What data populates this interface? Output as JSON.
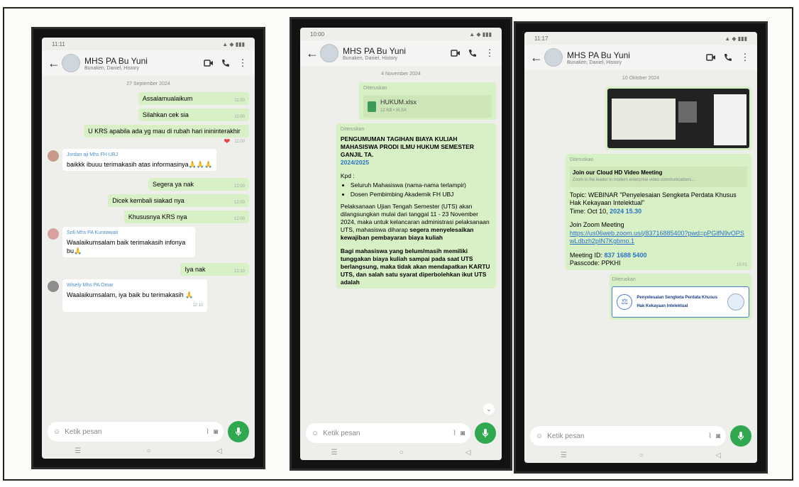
{
  "input_placeholder": "Ketik pesan",
  "phones": [
    {
      "status_time": "11:11",
      "title": "MHS PA Bu Yuni",
      "subtitle": "Bunaken, Daniel, History",
      "date": "27 September 2024",
      "messages": [
        {
          "text": "Assalamualaikum",
          "time": "11:00"
        },
        {
          "text": "Silahkan cek sia",
          "time": "11:00"
        },
        {
          "text": "U KRS apabila ada yg mau di rubah hari inininterakhir",
          "time": "11:00"
        }
      ],
      "incoming1": {
        "sender": "Jordan aji Mhs FH UBJ",
        "text": "baikkk ibuuu terimakasih atas informasinya🙏🙏🙏"
      },
      "messages2": [
        {
          "text": "Segera ya nak",
          "time": "12:00"
        },
        {
          "text": "Dicek kembali siakad nya",
          "time": "12:00"
        },
        {
          "text": "Khususnya KRS nya",
          "time": "12:00"
        }
      ],
      "incoming2": {
        "sender": "Sofi Mhs PA Kurniawati",
        "text": "Waalaikumsalam baik terimakasih infonya bu🙏"
      },
      "message3": {
        "text": "Iya nak",
        "time": "12:10"
      },
      "incoming3": {
        "sender": "Wisely Mhs PA Omar",
        "text": "Waalaikumsalam, iya baik bu terimakasih 🙏",
        "time": "12:10"
      }
    },
    {
      "status_time": "10:00",
      "title": "MHS PA Bu Yuni",
      "subtitle": "Bunaken, Daniel, History",
      "date": "4 November 2024",
      "forwarded": "Diteruskan",
      "file_name": "HUKUM.xlsx",
      "file_meta": "12 KB • XLSX",
      "announce_title": "PENGUMUMAN TAGIHAN BIAYA KULIAH MAHASISWA PRODI ILMU HUKUM SEMESTER GANJIL TA.",
      "announce_year": "2024/2025",
      "kpd": "Kpd :",
      "kpd_items": [
        "Seluruh Mahasiswa (nama-nama terlampir)",
        "Dosen Pembimbing Akademik FH UBJ"
      ],
      "para1": "Pelaksanaan Ujian Tengah Semester (UTS) akan dilangsungkan mulai dari tanggal 11 - 23 November 2024, maka untuk kelancaran administrasi pelaksanaan UTS, mahasiswa diharap",
      "para1_bold": "segera menyelesaikan kewajiban pembayaran biaya kuliah",
      "para2_bold": "Bagi mahasiswa yang belum/masih memiliki tunggakan biaya kuliah sampai pada saat UTS berlangsung, maka tidak akan mendapatkan KARTU UTS, dan salah satu syarat diperbolehkan ikut UTS adalah"
    },
    {
      "status_time": "11:17",
      "title": "MHS PA Bu Yuni",
      "subtitle": "Bunaken, Daniel, History",
      "date": "10 Oktober 2024",
      "forwarded": "Diteruskan",
      "zoom_title": "Join our Cloud HD Video Meeting",
      "zoom_desc": "Zoom is the leader in modern enterprise video communications...",
      "topic": "Topic: WEBINAR \"Penyelesaian Sengketa Perdata Khusus Hak Kekayaan Intelektual\"",
      "time_label": "Time: Oct 10,",
      "time_value": "2024 15.30",
      "join_label": "Join Zoom Meeting",
      "join_link": "https://us06web.zoom.us/j/83716885400?pwd=pPGlfN9vOPSwLdbzh2pIN7Kgbmo.1",
      "meeting_label": "Meeting ID:",
      "meeting_id": "837 1688 5400",
      "passcode": "Passcode: PPKHI",
      "msg_time": "15:01",
      "banner_text": "Penyelesaian Sengketa Perdata Khusus Hak Kekayaan Intelektual"
    }
  ],
  "colors": {
    "accent": "#2fa84f",
    "bubble_out": "#d8f0c6",
    "link": "#2a72c5"
  }
}
